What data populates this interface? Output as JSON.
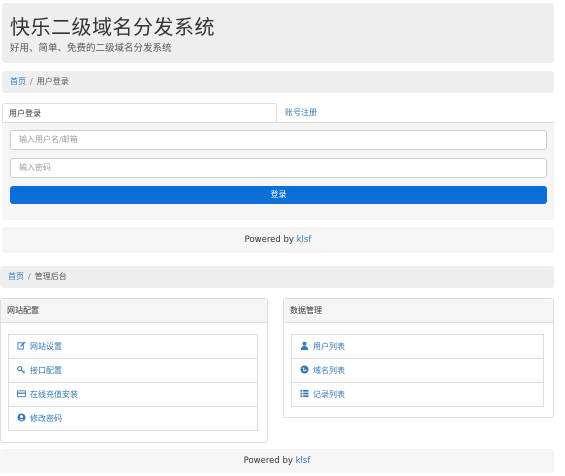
{
  "header": {
    "title": "快乐二级域名分发系统",
    "subtitle": "好用、简单、免费的二级域名分发系统"
  },
  "breadcrumb_login": {
    "home": "首页",
    "separator": "/",
    "current": "用户登录"
  },
  "login_tabs": {
    "active": "用户登录",
    "register": "账号注册"
  },
  "login_form": {
    "username_placeholder": "输入用户名/邮箱",
    "password_placeholder": "输入密码",
    "submit_label": "登录"
  },
  "footer_top": {
    "prefix": "Powered by",
    "link": "klsf"
  },
  "breadcrumb_admin": {
    "home": "首页",
    "separator": "/",
    "current": "管理后台"
  },
  "site_config": {
    "heading": "网站配置",
    "items": [
      {
        "label": "网站设置",
        "icon": "edit-icon"
      },
      {
        "label": "接口配置",
        "icon": "key-icon"
      },
      {
        "label": "在线充值安装",
        "icon": "credit-card-icon"
      },
      {
        "label": "修改密码",
        "icon": "user-circle-icon"
      }
    ]
  },
  "data_manage": {
    "heading": "数据管理",
    "items": [
      {
        "label": "用户列表",
        "icon": "user-icon"
      },
      {
        "label": "域名列表",
        "icon": "globe-icon"
      },
      {
        "label": "记录列表",
        "icon": "list-icon"
      }
    ]
  },
  "footer_bottom": {
    "prefix": "Powered by",
    "link": "klsf"
  },
  "colors": {
    "primary": "#0a6fd6",
    "link": "#337ab7",
    "well": "#eeeeee"
  }
}
